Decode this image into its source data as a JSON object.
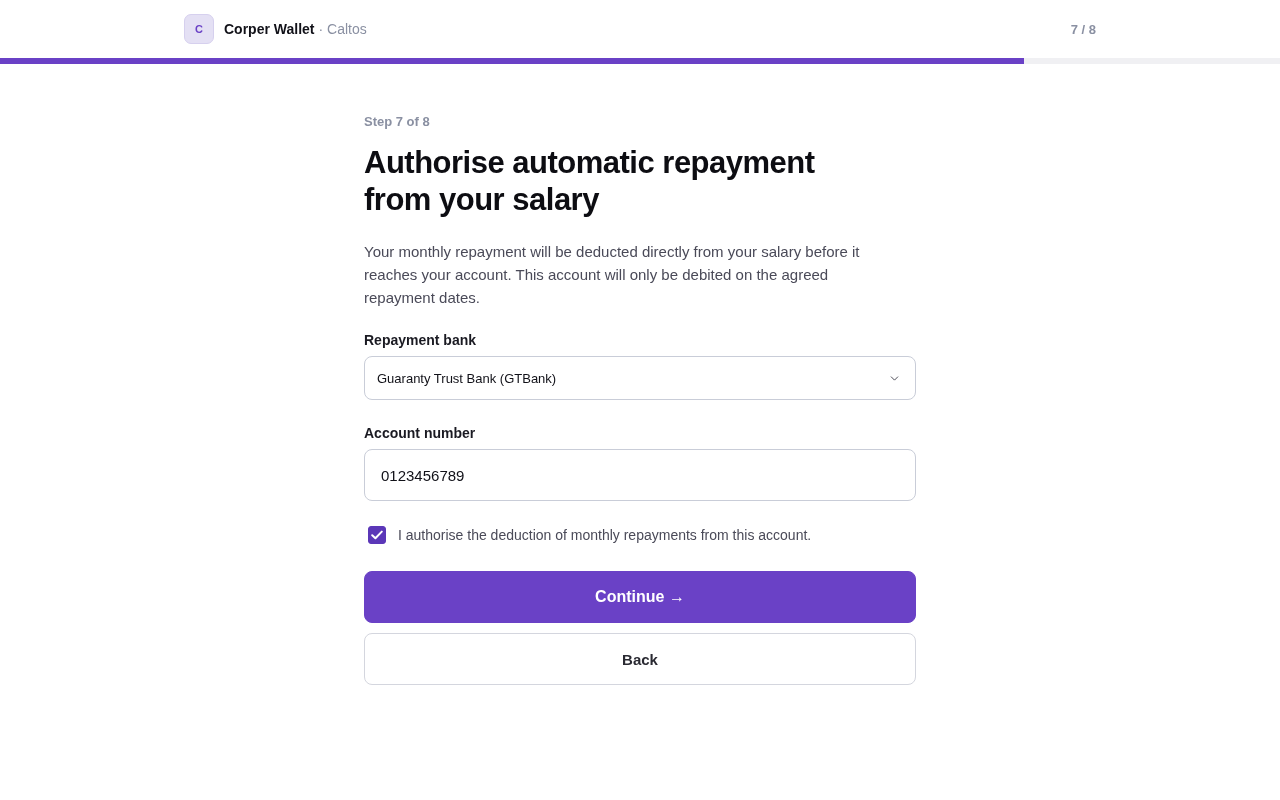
{
  "header": {
    "logo_letter": "C",
    "app_name": "Corper Wallet",
    "org": "· Caltos",
    "step_counter": "7 / 8"
  },
  "progress": {
    "level": 0.8
  },
  "step_label": "Step 7 of 8",
  "heading": "Authorise automatic repayment from your salary",
  "description": "Your monthly repayment will be deducted directly from your salary before it reaches your account. This account will only be debited on the agreed repayment dates.",
  "fields": [
    {
      "kind": "select",
      "label": "Repayment bank",
      "value": "Guaranty Trust Bank (GTBank)"
    },
    {
      "kind": "text",
      "label": "Account number",
      "value": "0123456789"
    }
  ],
  "consent": {
    "checked": true,
    "label": "I authorise the deduction of monthly repayments from this account."
  },
  "buttons": [
    {
      "kind": "primary",
      "label": "Continue →"
    },
    {
      "kind": "secondary",
      "label": "Back"
    }
  ]
}
